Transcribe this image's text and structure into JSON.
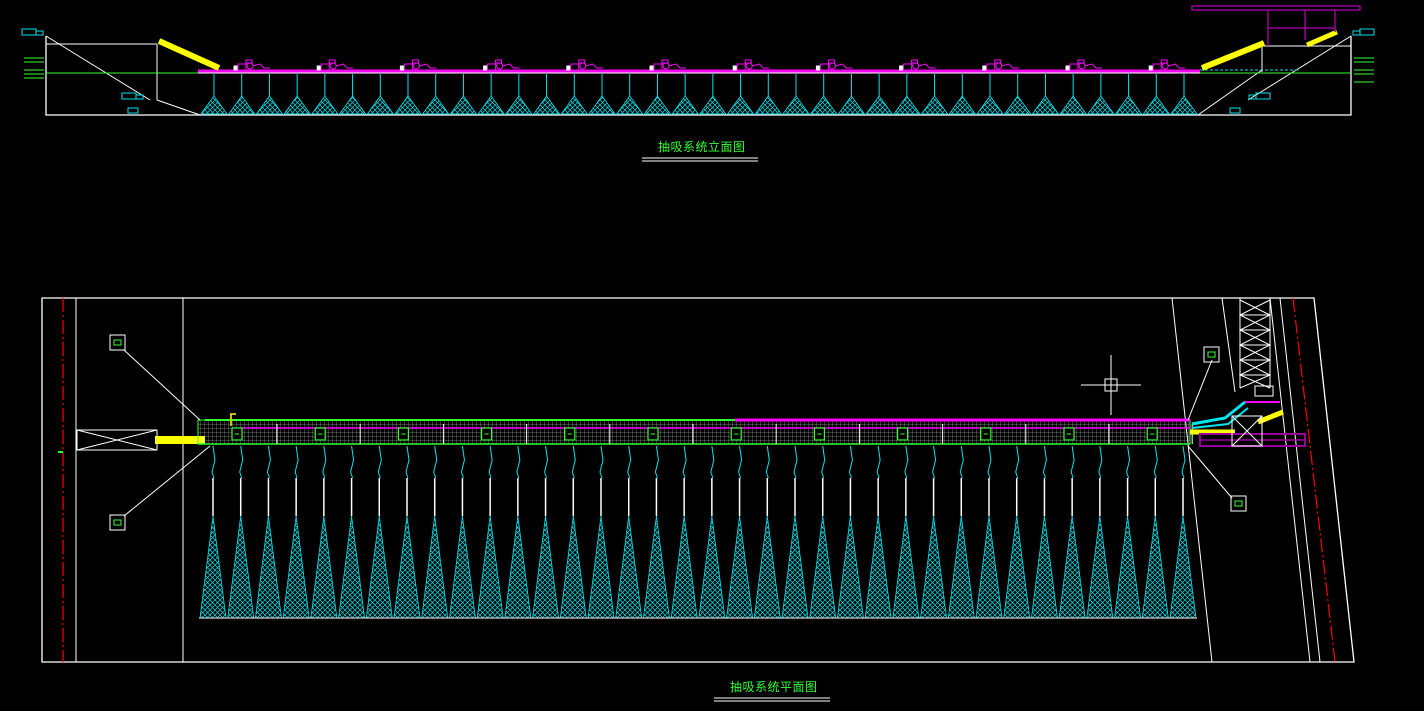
{
  "elevation_view": {
    "title": "抽吸系统立面图",
    "cone_count": 36,
    "pump_count": 12
  },
  "plan_view": {
    "title": "抽吸系统平面图",
    "cone_count": 36,
    "valve_count": 12
  },
  "colors": {
    "background": "#000000",
    "outline": "#ffffff",
    "cone": "#00e5ee",
    "pipe_magenta": "#ff00ff",
    "green": "#33ff33",
    "yellow": "#ffff00",
    "purple": "#990099",
    "red_dashed": "#ff0000"
  }
}
